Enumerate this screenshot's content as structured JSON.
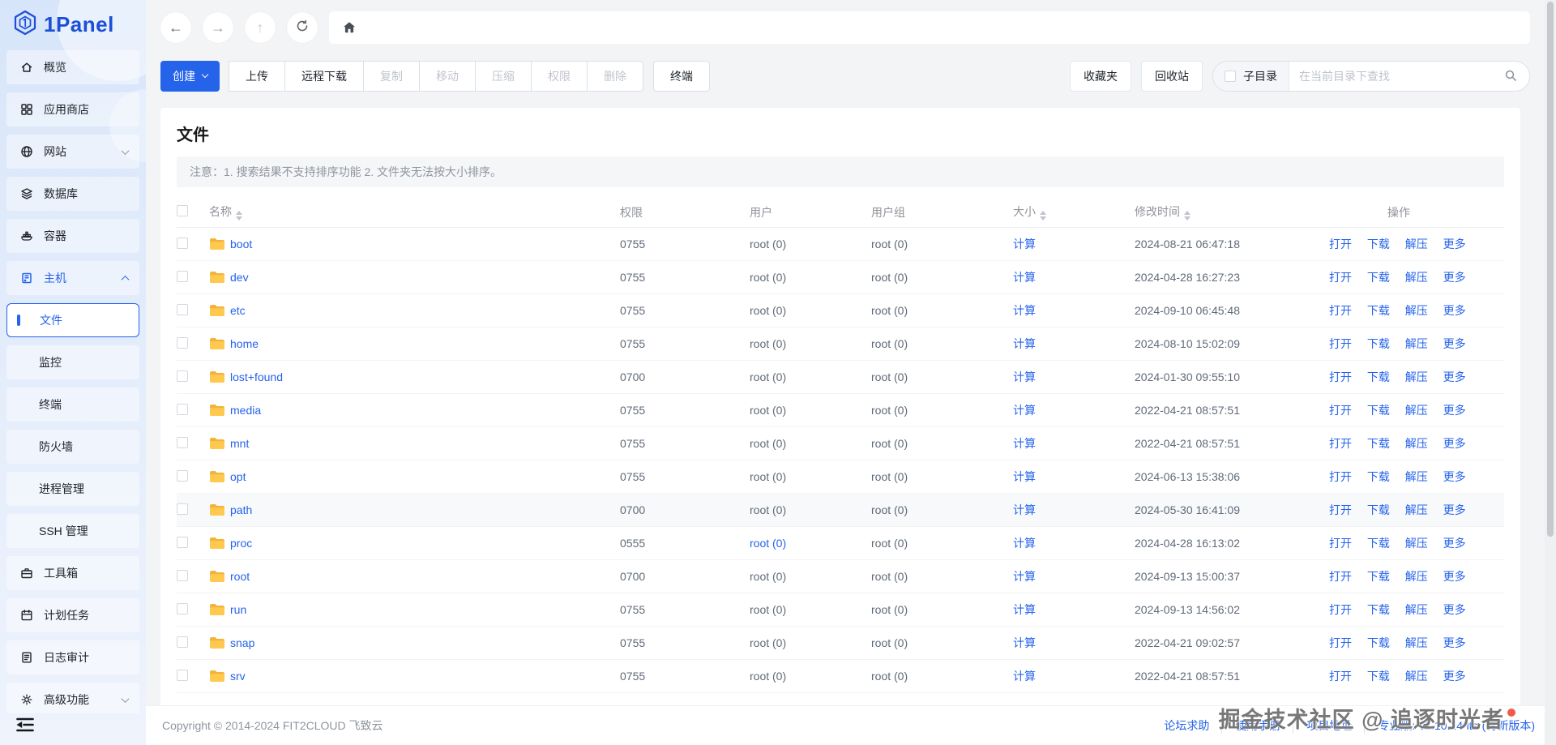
{
  "app": {
    "logo_text": "1Panel"
  },
  "colors": {
    "accent": "#2563eb",
    "folder_yellow": "#ffc94f",
    "badge_red": "#f25a48"
  },
  "sidebar": {
    "main_items": [
      {
        "label": "概览",
        "icon": "home-icon"
      },
      {
        "label": "应用商店",
        "icon": "appstore-icon"
      },
      {
        "label": "网站",
        "icon": "website-icon",
        "chevron": "down"
      },
      {
        "label": "数据库",
        "icon": "database-icon"
      },
      {
        "label": "容器",
        "icon": "container-icon"
      },
      {
        "label": "主机",
        "icon": "host-icon",
        "chevron": "up",
        "active": true
      }
    ],
    "host_submenu": [
      {
        "label": "文件",
        "active": true
      },
      {
        "label": "监控"
      },
      {
        "label": "终端"
      },
      {
        "label": "防火墙"
      },
      {
        "label": "进程管理"
      },
      {
        "label": "SSH 管理"
      }
    ],
    "bottom_items": [
      {
        "label": "工具箱",
        "icon": "toolbox-icon"
      },
      {
        "label": "计划任务",
        "icon": "cronjob-icon"
      },
      {
        "label": "日志审计",
        "icon": "logs-icon"
      },
      {
        "label": "高级功能",
        "icon": "advanced-icon",
        "chevron": "down"
      }
    ]
  },
  "toolbar": {
    "create_label": "创建",
    "group_buttons": [
      {
        "label": "上传",
        "enabled": true
      },
      {
        "label": "远程下载",
        "enabled": true
      },
      {
        "label": "复制",
        "enabled": false
      },
      {
        "label": "移动",
        "enabled": false
      },
      {
        "label": "压缩",
        "enabled": false
      },
      {
        "label": "权限",
        "enabled": false
      },
      {
        "label": "删除",
        "enabled": false
      }
    ],
    "terminal_label": "终端",
    "favorites_label": "收藏夹",
    "recycle_label": "回收站",
    "subdir_label": "子目录",
    "search_placeholder": "在当前目录下查找"
  },
  "page": {
    "title": "文件",
    "notice": "注意：1. 搜索结果不支持排序功能 2. 文件夹无法按大小排序。"
  },
  "table": {
    "headers": {
      "name": "名称",
      "perm": "权限",
      "user": "用户",
      "group": "用户组",
      "size": "大小",
      "mtime": "修改时间",
      "actions": "操作"
    },
    "size_link_label": "计算",
    "action_labels": [
      "打开",
      "下载",
      "解压",
      "更多"
    ],
    "rows": [
      {
        "name": "boot",
        "perm": "0755",
        "user": "root (0)",
        "group": "root (0)",
        "mtime": "2024-08-21 06:47:18"
      },
      {
        "name": "dev",
        "perm": "0755",
        "user": "root (0)",
        "group": "root (0)",
        "mtime": "2024-04-28 16:27:23"
      },
      {
        "name": "etc",
        "perm": "0755",
        "user": "root (0)",
        "group": "root (0)",
        "mtime": "2024-09-10 06:45:48"
      },
      {
        "name": "home",
        "perm": "0755",
        "user": "root (0)",
        "group": "root (0)",
        "mtime": "2024-08-10 15:02:09"
      },
      {
        "name": "lost+found",
        "perm": "0700",
        "user": "root (0)",
        "group": "root (0)",
        "mtime": "2024-01-30 09:55:10"
      },
      {
        "name": "media",
        "perm": "0755",
        "user": "root (0)",
        "group": "root (0)",
        "mtime": "2022-04-21 08:57:51"
      },
      {
        "name": "mnt",
        "perm": "0755",
        "user": "root (0)",
        "group": "root (0)",
        "mtime": "2022-04-21 08:57:51"
      },
      {
        "name": "opt",
        "perm": "0755",
        "user": "root (0)",
        "group": "root (0)",
        "mtime": "2024-06-13 15:38:06"
      },
      {
        "name": "path",
        "perm": "0700",
        "user": "root (0)",
        "group": "root (0)",
        "mtime": "2024-05-30 16:41:09",
        "highlighted": true
      },
      {
        "name": "proc",
        "perm": "0555",
        "user": "root (0)",
        "group": "root (0)",
        "mtime": "2024-04-28 16:13:02",
        "user_link": true
      },
      {
        "name": "root",
        "perm": "0700",
        "user": "root (0)",
        "group": "root (0)",
        "mtime": "2024-09-13 15:00:37"
      },
      {
        "name": "run",
        "perm": "0755",
        "user": "root (0)",
        "group": "root (0)",
        "mtime": "2024-09-13 14:56:02"
      },
      {
        "name": "snap",
        "perm": "0755",
        "user": "root (0)",
        "group": "root (0)",
        "mtime": "2022-04-21 09:02:57"
      },
      {
        "name": "srv",
        "perm": "0755",
        "user": "root (0)",
        "group": "root (0)",
        "mtime": "2022-04-21 08:57:51"
      }
    ]
  },
  "footer": {
    "copyright": "Copyright © 2014-2024 FIT2CLOUD 飞致云",
    "links": [
      "论坛求助",
      "使用手册",
      "项目地址"
    ],
    "edition_label": "专业版:",
    "version": "v1.10.14-lts",
    "update_hint": "(有新版本)"
  },
  "watermark": {
    "text": "掘金技术社区 @ 追逐时光者"
  }
}
